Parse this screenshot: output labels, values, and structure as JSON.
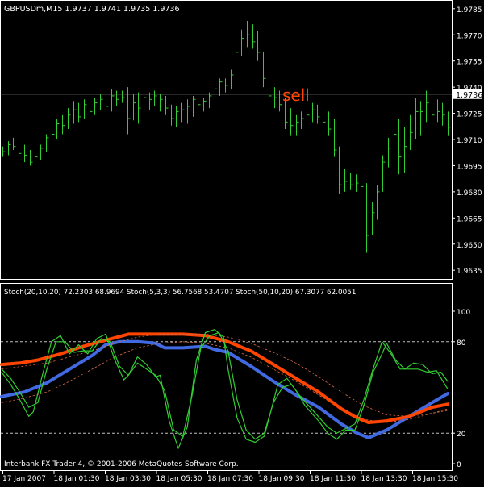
{
  "chart_data": {
    "type": "ohlc",
    "symbol_header": "GBPUSDm,M15  1.9737 1.9741 1.9735 1.9736",
    "annotation": "sell",
    "current_price": "1.9736",
    "price_axis": {
      "min": 1.963,
      "max": 1.979,
      "ticks": [
        "1.9785",
        "1.9770",
        "1.9755",
        "1.9740",
        "1.9725",
        "1.9710",
        "1.9695",
        "1.9680",
        "1.9665",
        "1.9650",
        "1.9635"
      ],
      "current": 1.9736
    },
    "time_labels": [
      "17 Jan 2007",
      "18 Jan 01:30",
      "18 Jan 03:30",
      "18 Jan 05:30",
      "18 Jan 07:30",
      "18 Jan 09:30",
      "18 Jan 11:30",
      "18 Jan 13:30",
      "18 Jan 15:30"
    ],
    "price_bars": [
      [
        1.9706,
        1.97,
        1.9703
      ],
      [
        1.9709,
        1.9701,
        1.9707
      ],
      [
        1.9711,
        1.9704,
        1.9706
      ],
      [
        1.9709,
        1.97,
        1.9702
      ],
      [
        1.9707,
        1.9697,
        1.9701
      ],
      [
        1.9704,
        1.9695,
        1.9697
      ],
      [
        1.9702,
        1.9692,
        1.97
      ],
      [
        1.9707,
        1.9698,
        1.9705
      ],
      [
        1.9713,
        1.9703,
        1.9711
      ],
      [
        1.9717,
        1.9706,
        1.9713
      ],
      [
        1.9722,
        1.971,
        1.9719
      ],
      [
        1.9724,
        1.9713,
        1.9718
      ],
      [
        1.9728,
        1.9716,
        1.9724
      ],
      [
        1.9732,
        1.9719,
        1.9727
      ],
      [
        1.9731,
        1.972,
        1.9723
      ],
      [
        1.9733,
        1.9722,
        1.973
      ],
      [
        1.9732,
        1.9721,
        1.9726
      ],
      [
        1.9734,
        1.9724,
        1.9731
      ],
      [
        1.9736,
        1.9727,
        1.9733
      ],
      [
        1.9737,
        1.9723,
        1.9729
      ],
      [
        1.9739,
        1.9726,
        1.9735
      ],
      [
        1.9738,
        1.9729,
        1.9733
      ],
      [
        1.9738,
        1.9731,
        1.9734
      ],
      [
        1.974,
        1.9713,
        1.9722
      ],
      [
        1.9736,
        1.9721,
        1.9731
      ],
      [
        1.9737,
        1.9719,
        1.9728
      ],
      [
        1.9736,
        1.9721,
        1.9734
      ],
      [
        1.9737,
        1.9727,
        1.9733
      ],
      [
        1.9738,
        1.9729,
        1.9735
      ],
      [
        1.9736,
        1.9726,
        1.9733
      ],
      [
        1.9735,
        1.9724,
        1.9728
      ],
      [
        1.973,
        1.9718,
        1.9722
      ],
      [
        1.9729,
        1.9717,
        1.9726
      ],
      [
        1.9731,
        1.972,
        1.9727
      ],
      [
        1.9733,
        1.9719,
        1.9729
      ],
      [
        1.9735,
        1.9723,
        1.9733
      ],
      [
        1.9734,
        1.9725,
        1.973
      ],
      [
        1.9734,
        1.9726,
        1.9732
      ],
      [
        1.9737,
        1.9728,
        1.9735
      ],
      [
        1.9741,
        1.9732,
        1.9739
      ],
      [
        1.9745,
        1.9735,
        1.9743
      ],
      [
        1.9745,
        1.9737,
        1.9741
      ],
      [
        1.975,
        1.9739,
        1.9747
      ],
      [
        1.9765,
        1.9745,
        1.976
      ],
      [
        1.9773,
        1.9758,
        1.9768
      ],
      [
        1.9778,
        1.9763,
        1.977
      ],
      [
        1.9776,
        1.9762,
        1.9766
      ],
      [
        1.9772,
        1.9755,
        1.976
      ],
      [
        1.976,
        1.974,
        1.9745
      ],
      [
        1.9746,
        1.9728,
        1.9735
      ],
      [
        1.974,
        1.9728,
        1.9734
      ],
      [
        1.9738,
        1.9726,
        1.973
      ],
      [
        1.9734,
        1.9716,
        1.972
      ],
      [
        1.9728,
        1.9712,
        1.9718
      ],
      [
        1.9724,
        1.9712,
        1.972
      ],
      [
        1.9726,
        1.9716,
        1.9722
      ],
      [
        1.9729,
        1.9718,
        1.9724
      ],
      [
        1.9731,
        1.972,
        1.9727
      ],
      [
        1.973,
        1.9719,
        1.9723
      ],
      [
        1.9728,
        1.9716,
        1.972
      ],
      [
        1.9726,
        1.9712,
        1.9716
      ],
      [
        1.9722,
        1.97,
        1.9704
      ],
      [
        1.9706,
        1.9679,
        1.9684
      ],
      [
        1.9693,
        1.968,
        1.9686
      ],
      [
        1.9691,
        1.9681,
        1.9684
      ],
      [
        1.969,
        1.968,
        1.9685
      ],
      [
        1.9688,
        1.9679,
        1.9683
      ],
      [
        1.9685,
        1.9645,
        1.9655
      ],
      [
        1.9674,
        1.9655,
        1.9668
      ],
      [
        1.9684,
        1.9664,
        1.968
      ],
      [
        1.9701,
        1.968,
        1.9697
      ],
      [
        1.9711,
        1.9694,
        1.9705
      ],
      [
        1.9738,
        1.9702,
        1.9713
      ],
      [
        1.9722,
        1.969,
        1.97
      ],
      [
        1.9717,
        1.9691,
        1.9706
      ],
      [
        1.9724,
        1.9704,
        1.9714
      ],
      [
        1.9734,
        1.971,
        1.9726
      ],
      [
        1.9732,
        1.9712,
        1.9726
      ],
      [
        1.9738,
        1.972,
        1.9731
      ],
      [
        1.9734,
        1.9718,
        1.9724
      ],
      [
        1.9733,
        1.972,
        1.9726
      ],
      [
        1.9731,
        1.9718,
        1.9724
      ],
      [
        1.9726,
        1.9712,
        1.9717
      ]
    ],
    "stoch_header": "Stoch(20,10,20) 72.2303 68.9694  Stoch(5,3,3) 56.7568 53.4707  Stoch(50,10,20) 67.3077 62.0051",
    "stoch_axis": {
      "min": 0,
      "max": 100,
      "ticks": [
        "100",
        "80",
        "20",
        "0"
      ],
      "levels": [
        80,
        20
      ]
    },
    "series": [
      {
        "name": "Stoch(20,10,20)",
        "color": "#4169e1",
        "width": 4,
        "values": [
          [
            0,
            44
          ],
          [
            10,
            47
          ],
          [
            20,
            53
          ],
          [
            30,
            62
          ],
          [
            40,
            71
          ],
          [
            46,
            78
          ],
          [
            52,
            80
          ],
          [
            60,
            80
          ],
          [
            68,
            79
          ],
          [
            72,
            76
          ],
          [
            80,
            76
          ],
          [
            90,
            77
          ],
          [
            94,
            75
          ],
          [
            100,
            73
          ],
          [
            110,
            64
          ],
          [
            120,
            54
          ],
          [
            130,
            45
          ],
          [
            140,
            37
          ],
          [
            150,
            26
          ],
          [
            157,
            20
          ],
          [
            162,
            17
          ],
          [
            170,
            22
          ],
          [
            180,
            31
          ],
          [
            190,
            40
          ],
          [
            197,
            46
          ]
        ]
      },
      {
        "name": "Stoch(20,10,20) signal",
        "color": "#d86a48",
        "width": 0.8,
        "dash": "2,3",
        "values": [
          [
            0,
            40
          ],
          [
            10,
            43
          ],
          [
            20,
            47
          ],
          [
            30,
            54
          ],
          [
            40,
            62
          ],
          [
            50,
            70
          ],
          [
            60,
            76
          ],
          [
            70,
            79
          ],
          [
            80,
            80
          ],
          [
            90,
            79
          ],
          [
            100,
            76
          ],
          [
            110,
            70
          ],
          [
            120,
            62
          ],
          [
            130,
            54
          ],
          [
            140,
            45
          ],
          [
            150,
            36
          ],
          [
            160,
            29
          ],
          [
            170,
            27
          ],
          [
            180,
            29
          ],
          [
            190,
            33
          ],
          [
            197,
            36
          ]
        ]
      },
      {
        "name": "Stoch(50,10,20)",
        "color": "#ff4500",
        "width": 4,
        "values": [
          [
            0,
            65
          ],
          [
            8,
            66
          ],
          [
            16,
            68
          ],
          [
            26,
            72
          ],
          [
            36,
            77
          ],
          [
            46,
            81
          ],
          [
            56,
            85
          ],
          [
            64,
            85
          ],
          [
            72,
            85
          ],
          [
            80,
            85
          ],
          [
            90,
            84
          ],
          [
            100,
            80
          ],
          [
            110,
            74
          ],
          [
            120,
            65
          ],
          [
            130,
            56
          ],
          [
            140,
            47
          ],
          [
            150,
            36
          ],
          [
            157,
            30
          ],
          [
            162,
            27
          ],
          [
            170,
            28
          ],
          [
            180,
            31
          ],
          [
            190,
            37
          ],
          [
            197,
            39
          ]
        ]
      },
      {
        "name": "Stoch(50,10,20) signal",
        "color": "#d86a48",
        "width": 0.8,
        "dash": "2,3",
        "values": [
          [
            0,
            62
          ],
          [
            10,
            64
          ],
          [
            20,
            66
          ],
          [
            30,
            70
          ],
          [
            40,
            74
          ],
          [
            50,
            79
          ],
          [
            60,
            83
          ],
          [
            70,
            85
          ],
          [
            80,
            85
          ],
          [
            90,
            85
          ],
          [
            100,
            83
          ],
          [
            110,
            79
          ],
          [
            120,
            73
          ],
          [
            130,
            66
          ],
          [
            140,
            57
          ],
          [
            150,
            47
          ],
          [
            160,
            38
          ],
          [
            170,
            32
          ],
          [
            180,
            31
          ],
          [
            190,
            33
          ],
          [
            197,
            35
          ]
        ]
      },
      {
        "name": "Stoch(5,3,3)",
        "color": "#32cd32",
        "width": 1.2,
        "values": [
          [
            0,
            60
          ],
          [
            4,
            52
          ],
          [
            8,
            42
          ],
          [
            12,
            31
          ],
          [
            14,
            34
          ],
          [
            18,
            58
          ],
          [
            22,
            80
          ],
          [
            26,
            84
          ],
          [
            30,
            72
          ],
          [
            34,
            78
          ],
          [
            38,
            72
          ],
          [
            42,
            82
          ],
          [
            46,
            85
          ],
          [
            50,
            68
          ],
          [
            54,
            55
          ],
          [
            56,
            58
          ],
          [
            60,
            70
          ],
          [
            64,
            65
          ],
          [
            68,
            57
          ],
          [
            70,
            58
          ],
          [
            74,
            28
          ],
          [
            78,
            10
          ],
          [
            82,
            24
          ],
          [
            86,
            68
          ],
          [
            90,
            86
          ],
          [
            94,
            88
          ],
          [
            98,
            83
          ],
          [
            100,
            62
          ],
          [
            104,
            30
          ],
          [
            108,
            16
          ],
          [
            112,
            14
          ],
          [
            116,
            18
          ],
          [
            122,
            52
          ],
          [
            126,
            56
          ],
          [
            130,
            48
          ],
          [
            134,
            38
          ],
          [
            140,
            28
          ],
          [
            144,
            20
          ],
          [
            148,
            16
          ],
          [
            152,
            22
          ],
          [
            156,
            22
          ],
          [
            160,
            38
          ],
          [
            164,
            60
          ],
          [
            168,
            72
          ],
          [
            170,
            79
          ],
          [
            174,
            68
          ],
          [
            178,
            62
          ],
          [
            182,
            66
          ],
          [
            186,
            65
          ],
          [
            190,
            59
          ],
          [
            194,
            60
          ],
          [
            197,
            54
          ]
        ]
      },
      {
        "name": "Stoch(5,3,3) signal",
        "color": "#32cd32",
        "width": 1.2,
        "values": [
          [
            0,
            62
          ],
          [
            4,
            56
          ],
          [
            8,
            47
          ],
          [
            12,
            37
          ],
          [
            16,
            40
          ],
          [
            20,
            62
          ],
          [
            24,
            80
          ],
          [
            28,
            80
          ],
          [
            32,
            73
          ],
          [
            36,
            74
          ],
          [
            40,
            74
          ],
          [
            44,
            82
          ],
          [
            48,
            80
          ],
          [
            52,
            64
          ],
          [
            56,
            58
          ],
          [
            60,
            66
          ],
          [
            64,
            62
          ],
          [
            68,
            58
          ],
          [
            72,
            48
          ],
          [
            76,
            22
          ],
          [
            80,
            18
          ],
          [
            84,
            44
          ],
          [
            88,
            76
          ],
          [
            92,
            84
          ],
          [
            96,
            86
          ],
          [
            100,
            74
          ],
          [
            104,
            42
          ],
          [
            108,
            22
          ],
          [
            112,
            16
          ],
          [
            116,
            20
          ],
          [
            120,
            40
          ],
          [
            124,
            50
          ],
          [
            128,
            52
          ],
          [
            132,
            44
          ],
          [
            138,
            34
          ],
          [
            144,
            24
          ],
          [
            148,
            20
          ],
          [
            152,
            23
          ],
          [
            156,
            26
          ],
          [
            160,
            42
          ],
          [
            164,
            62
          ],
          [
            168,
            80
          ],
          [
            172,
            72
          ],
          [
            176,
            62
          ],
          [
            180,
            62
          ],
          [
            184,
            62
          ],
          [
            188,
            60
          ],
          [
            192,
            61
          ],
          [
            197,
            49
          ]
        ]
      }
    ]
  },
  "footer": "Interbank FX Trader 4, © 2001-2006 MetaQuotes Software Corp."
}
